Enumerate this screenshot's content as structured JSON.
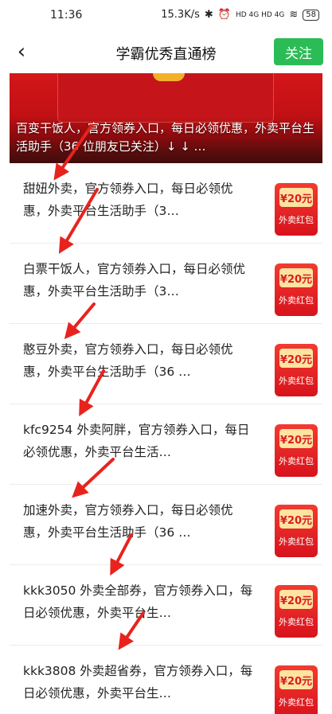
{
  "status_bar": {
    "time": "11:36",
    "network_speed": "15.3K/s",
    "signal": "HD 4G HD 4G",
    "battery": "58"
  },
  "header": {
    "back_icon": "chevron-left-icon",
    "title": "学霸优秀直通榜",
    "follow_label": "关注"
  },
  "banner": {
    "text": "百变干饭人，官方领券入口，每日必领优惠，外卖平台生活助手（36 位朋友已关注）↓ ↓ …"
  },
  "items": [
    {
      "text": "甜妞外卖，官方领券入口，每日必领优惠，外卖平台生活助手（3…"
    },
    {
      "text": "白票干饭人，官方领券入口，每日必领优惠，外卖平台生活助手（3…"
    },
    {
      "text": "憨豆外卖，官方领券入口，每日必领优惠，外卖平台生活助手（36 …"
    },
    {
      "text": "kfc9254 外卖阿胖，官方领券入口，每日必领优惠，外卖平台生活…"
    },
    {
      "text": "加速外卖，官方领券入口，每日必领优惠，外卖平台生活助手（36 …"
    },
    {
      "text": "kkk3050 外卖全部券，官方领券入口，每日必领优惠，外卖平台生…"
    },
    {
      "text": "kkk3808 外卖超省券，官方领券入口，每日必领优惠，外卖平台生…"
    }
  ],
  "coupon": {
    "amount": "¥20元",
    "label": "外卖红包"
  },
  "colors": {
    "accent_green": "#2cbc56",
    "coupon_red": "#e0241c",
    "arrow_red": "#e8231d"
  }
}
